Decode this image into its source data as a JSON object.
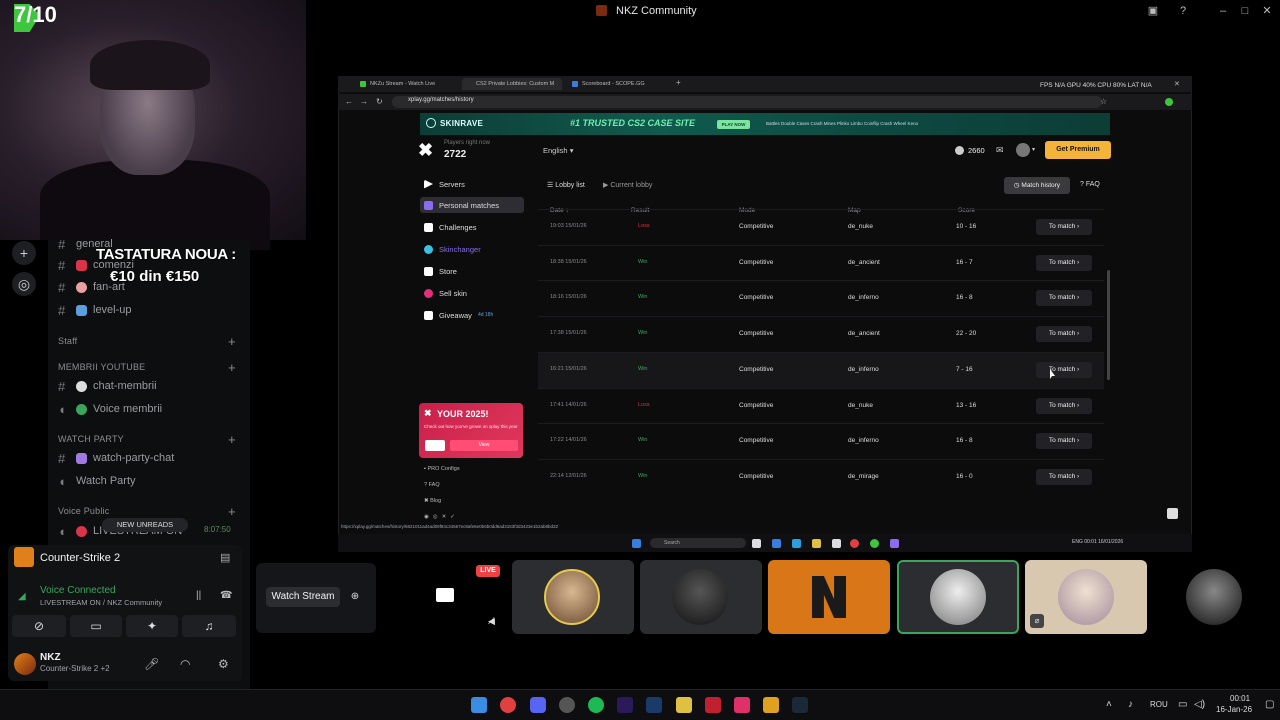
{
  "window": {
    "title": "NKZ Community"
  },
  "overlay": {
    "rating": "7/10",
    "text1": "TASTATURA NOUA :",
    "text2": "€10 din €150"
  },
  "channels": {
    "partial_top": "general",
    "items": [
      {
        "label": "comenzi",
        "color": "#d9344a"
      },
      {
        "label": "fan-art",
        "color": "#e8a0a0"
      },
      {
        "label": "level-up",
        "color": "#5aa0e0"
      }
    ],
    "staff_label": "Staff",
    "youtube_category": "MEMBRII YOUTUBE",
    "youtube_items": [
      {
        "label": "chat-membrii"
      },
      {
        "label": "Voice membrii"
      }
    ],
    "watchparty_category": "WATCH PARTY",
    "watchparty_items": [
      {
        "label": "watch-party-chat"
      },
      {
        "label": "Watch Party"
      }
    ],
    "voice_public": "Voice Public",
    "partial_voice": "LIVESTREAM ON",
    "new_unreads": "NEW UNREADS",
    "voice_time": "8:07:50"
  },
  "activity": {
    "game": "Counter-Strike 2",
    "voice_connected": "Voice Connected",
    "voice_sub": "LIVESTREAM ON / NKZ Community"
  },
  "user": {
    "name": "NKZ",
    "status": "Counter-Strike 2 +2"
  },
  "browser": {
    "tabs": [
      "NKZu Stream - Watch Live",
      "CS2 Private Lobbies: Custom M",
      "Scoreboard - SCOPE.GG"
    ],
    "url": "xplay.gg/matches/history",
    "perf": "FPS N/A   GPU 40%   CPU 80%   LAT N/A",
    "status_url": "https://xplay.gg/matches/history/6821011ad4ad08f84c34567ec8afe6e0b6b0dd6ad3153f3d3423e1b2ab8bd32"
  },
  "banner": {
    "brand": "SKINRAVE",
    "title": "#1 TRUSTED CS2 CASE SITE",
    "play": "PLAY NOW",
    "links": "Battles  Double  Cases  Crash  Mines  Plinko  Limbo  Coinflip  Crash  Wheel  Keno"
  },
  "site": {
    "players_label": "Players right now",
    "players_count": "2722",
    "language": "English",
    "coins": "2660",
    "premium": "Get Premium",
    "nav": [
      {
        "label": "Servers",
        "color": "#ffffff"
      },
      {
        "label": "Personal matches",
        "color": "#8a6cf0"
      },
      {
        "label": "Challenges",
        "color": "#ffffff"
      },
      {
        "label": "Skinchanger",
        "color": "#7a5cf0"
      },
      {
        "label": "Store",
        "color": "#ffffff"
      },
      {
        "label": "Sell skin",
        "color": "#e0307a"
      },
      {
        "label": "Giveaway",
        "color": "#ffffff"
      }
    ],
    "giveaway_timer": "4d 18h",
    "promo": {
      "title": "YOUR 2025!",
      "sub": "Check out how you've grown on xplay this year",
      "btn": "View"
    },
    "footer": [
      "PRO Configs",
      "FAQ",
      "Blog"
    ],
    "lobby_list": "Lobby list",
    "current_lobby": "Current lobby",
    "match_history": "Match history",
    "faq": "FAQ"
  },
  "table": {
    "headers": [
      "Date",
      "Result",
      "Mode",
      "Map",
      "Score"
    ],
    "rows": [
      {
        "date": "19:03 15/01/26",
        "result": "Loss",
        "mode": "Competitive",
        "map": "de_nuke",
        "score": "10 - 16"
      },
      {
        "date": "18:38 15/01/26",
        "result": "Win",
        "mode": "Competitive",
        "map": "de_ancient",
        "score": "16 - 7"
      },
      {
        "date": "18:16 15/01/26",
        "result": "Win",
        "mode": "Competitive",
        "map": "de_inferno",
        "score": "16 - 8"
      },
      {
        "date": "17:38 15/01/26",
        "result": "Win",
        "mode": "Competitive",
        "map": "de_ancient",
        "score": "22 - 20"
      },
      {
        "date": "16:21 15/01/26",
        "result": "Win",
        "mode": "Competitive",
        "map": "de_inferno",
        "score": "7 - 16"
      },
      {
        "date": "17:41 14/01/26",
        "result": "Loss",
        "mode": "Competitive",
        "map": "de_nuke",
        "score": "13 - 16"
      },
      {
        "date": "17:22 14/01/26",
        "result": "Win",
        "mode": "Competitive",
        "map": "de_inferno",
        "score": "16 - 8"
      },
      {
        "date": "22:14 12/01/26",
        "result": "Win",
        "mode": "Competitive",
        "map": "de_mirage",
        "score": "16 - 0"
      }
    ],
    "action_label": "To match"
  },
  "inner_taskbar": {
    "search": "Search",
    "tray": "ENG   00:01\n16/01/2026"
  },
  "stage": {
    "watch_stream": "Watch Stream",
    "live": "LIVE"
  },
  "os_taskbar": {
    "lang": "ROU",
    "time": "00:01",
    "date": "16-Jan-26"
  }
}
